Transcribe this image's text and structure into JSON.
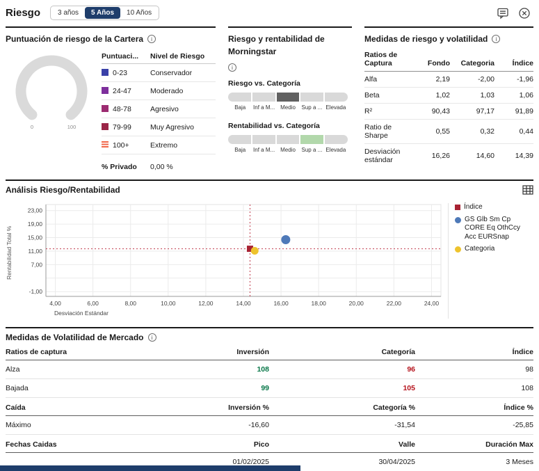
{
  "header": {
    "title": "Riesgo",
    "periods": [
      {
        "label": "3 años",
        "selected": false
      },
      {
        "label": "5 Años",
        "selected": true
      },
      {
        "label": "10 Años",
        "selected": false
      }
    ]
  },
  "icons": {
    "info_char": "i",
    "feedback_icon": "comment-bubble",
    "close_icon": "circle-x",
    "grid_icon": "table-grid"
  },
  "colors": {
    "accent_navy": "#1e3d6b",
    "positive_green": "#067647",
    "negative_red": "#b5121b",
    "bar_base_gray": "#d9d9d9",
    "bar_selected_gray": "#616161",
    "bar_selected_green": "#b2d8ab"
  },
  "portfolio_risk": {
    "title": "Puntuación de riesgo de la Cartera",
    "gauge": {
      "min": "0",
      "max": "100"
    },
    "table": {
      "col1": "Puntuaci...",
      "col2": "Nivel de Riesgo",
      "rows": [
        {
          "range": "0-23",
          "level": "Conservador",
          "color": "#3a41a8"
        },
        {
          "range": "24-47",
          "level": "Moderado",
          "color": "#7e2f9c"
        },
        {
          "range": "48-78",
          "level": "Agresivo",
          "color": "#9c2b71"
        },
        {
          "range": "79-99",
          "level": "Muy Agresivo",
          "color": "#9a2547"
        },
        {
          "range": "100+",
          "level": "Extremo",
          "color": "#f26649"
        }
      ]
    },
    "private_label": "% Privado",
    "private_value": "0,00 %"
  },
  "morningstar": {
    "title": "Riesgo y rentabilidad de Morningstar",
    "risk_label": "Riesgo vs. Categoría",
    "return_label": "Rentabilidad vs. Categoría",
    "scale_labels": [
      "Baja",
      "Inf a M...",
      "Medio",
      "Sup a ...",
      "Elevada"
    ],
    "risk_selected_index": 2,
    "return_selected_index": 3
  },
  "risk_measures": {
    "title": "Medidas de riesgo y volatilidad",
    "headers": [
      "Ratios de Captura",
      "Fondo",
      "Categoria",
      "Índice"
    ],
    "rows": [
      {
        "label": "Alfa",
        "values": [
          "2,19",
          "-2,00",
          "-1,96"
        ]
      },
      {
        "label": "Beta",
        "values": [
          "1,02",
          "1,03",
          "1,06"
        ]
      },
      {
        "label": "R²",
        "values": [
          "90,43",
          "97,17",
          "91,89"
        ]
      },
      {
        "label": "Ratio de Sharpe",
        "values": [
          "0,55",
          "0,32",
          "0,44"
        ]
      },
      {
        "label": "Desviación estándar",
        "values": [
          "16,26",
          "14,60",
          "14,39"
        ]
      }
    ]
  },
  "chart_data": {
    "type": "scatter",
    "title": "Análisis Riesgo/Rentabilidad",
    "xlabel": "Desviación Estándar",
    "ylabel": "Rentabilidad Total %",
    "xlim": [
      3.5,
      24.5
    ],
    "ylim": [
      -2.4,
      24.8
    ],
    "x_ticks": [
      4,
      6,
      8,
      10,
      12,
      14,
      16,
      18,
      20,
      22,
      24
    ],
    "x_tick_labels": [
      "4,00",
      "6,00",
      "8,00",
      "10,00",
      "12,00",
      "14,00",
      "16,00",
      "18,00",
      "20,00",
      "22,00",
      "24,00"
    ],
    "y_ticks": [
      23,
      19,
      15,
      11,
      7,
      -1
    ],
    "y_tick_labels": [
      "23,00",
      "19,00",
      "15,00",
      "11,00",
      "7,00",
      "-1,00"
    ],
    "y_gridlines": [
      23,
      19,
      15,
      11,
      7,
      3,
      -1
    ],
    "grid": true,
    "legend_position": "right",
    "crosshair": {
      "x": 14.35,
      "y": 11.7,
      "color": "#c0394b"
    },
    "series": [
      {
        "name": "Índice",
        "marker": "square",
        "color": "#a82333",
        "size": 9,
        "x": 14.35,
        "y": 11.7
      },
      {
        "name": "GS Glb Sm Cp CORE Eq OthCcy Acc EURSnap",
        "marker": "circle",
        "color": "#4e79b8",
        "size": 6.5,
        "x": 16.25,
        "y": 14.4
      },
      {
        "name": "Categoria",
        "marker": "circle",
        "color": "#eec32d",
        "size": 5.5,
        "x": 14.6,
        "y": 11.1
      }
    ]
  },
  "volatility": {
    "title": "Medidas de Volatilidad de Mercado",
    "capture": {
      "headers": [
        "Ratios de captura",
        "Inversión",
        "Categoría",
        "Índice"
      ],
      "rows": [
        {
          "label": "Alza",
          "inv": "108",
          "cat": "96",
          "idx": "98"
        },
        {
          "label": "Bajada",
          "inv": "99",
          "cat": "105",
          "idx": "108"
        }
      ]
    },
    "drawdown": {
      "headers": [
        "Caída",
        "Inversión %",
        "Categoría %",
        "Índice %"
      ],
      "row": {
        "label": "Máximo",
        "inv": "-16,60",
        "cat": "-31,54",
        "idx": "-25,85"
      }
    },
    "dates": {
      "headers": [
        "Fechas Caidas",
        "Pico",
        "Valle",
        "Duración Max"
      ],
      "row": {
        "label": "",
        "pico": "01/02/2025",
        "valle": "30/04/2025",
        "dur": "3 Meses"
      }
    }
  }
}
